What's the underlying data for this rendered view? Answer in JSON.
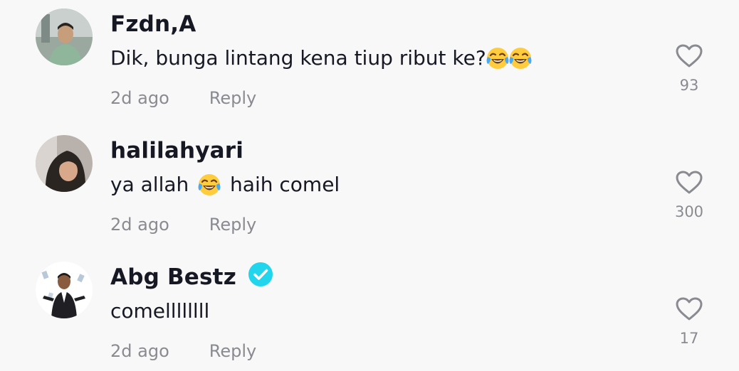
{
  "comments": [
    {
      "username": "Fzdn,A",
      "verified": false,
      "text_before": "Dik, bunga lintang kena tiup ribut ke?",
      "emoji_1": "😂",
      "text_after": "",
      "emoji_2": "😂",
      "time": "2d ago",
      "reply_label": "Reply",
      "like_count": "93"
    },
    {
      "username": "halilahyari",
      "verified": false,
      "text_before": "ya allah ",
      "emoji_1": "😂",
      "text_after": " haih comel",
      "time": "2d ago",
      "reply_label": "Reply",
      "like_count": "300"
    },
    {
      "username": "Abg Bestz",
      "verified": true,
      "text_before": "comellllllll",
      "time": "2d ago",
      "reply_label": "Reply",
      "like_count": "17"
    }
  ],
  "colors": {
    "background": "#f8f8f8",
    "text_primary": "#161823",
    "text_secondary": "#8a8b91",
    "verified_badge": "#20d5ec"
  },
  "icons": {
    "heart": "heart-outline-icon",
    "verified": "verified-badge-icon",
    "emoji": "face-with-tears-of-joy-emoji"
  }
}
